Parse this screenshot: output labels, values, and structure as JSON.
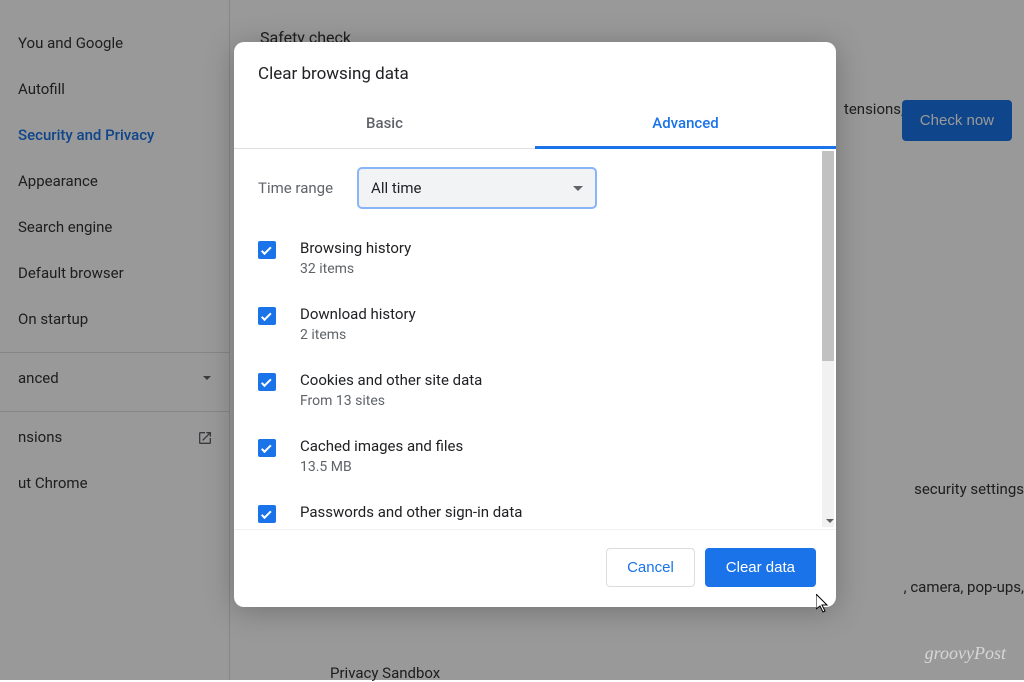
{
  "sidebar": {
    "items": [
      {
        "label": "You and Google"
      },
      {
        "label": "Autofill"
      },
      {
        "label": "Security and Privacy"
      },
      {
        "label": "Appearance"
      },
      {
        "label": "Search engine"
      },
      {
        "label": "Default browser"
      },
      {
        "label": "On startup"
      }
    ],
    "advanced_label": "anced",
    "extensions_label": "nsions",
    "about_label": "ut Chrome"
  },
  "background": {
    "safety_heading": "Safety check",
    "extensions_text": "tensions,",
    "check_now_label": "Check now",
    "security_settings": "security settings",
    "camera_popups": ", camera, pop-ups,",
    "privacy_sandbox": "Privacy Sandbox"
  },
  "modal": {
    "title": "Clear browsing data",
    "tabs": {
      "basic": "Basic",
      "advanced": "Advanced"
    },
    "time_range_label": "Time range",
    "time_range_value": "All time",
    "items": [
      {
        "title": "Browsing history",
        "sub": "32 items"
      },
      {
        "title": "Download history",
        "sub": "2 items"
      },
      {
        "title": "Cookies and other site data",
        "sub": "From 13 sites"
      },
      {
        "title": "Cached images and files",
        "sub": "13.5 MB"
      },
      {
        "title": "Passwords and other sign-in data",
        "sub": ""
      }
    ],
    "cancel_label": "Cancel",
    "clear_label": "Clear data"
  },
  "watermark": "groovyPost"
}
